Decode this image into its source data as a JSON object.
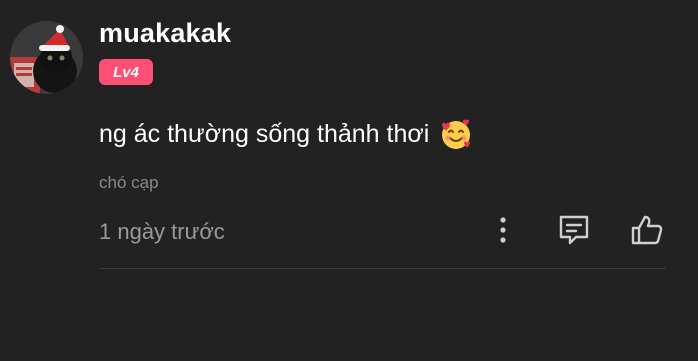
{
  "comment": {
    "username": "muakakak",
    "level": "Lv4",
    "text": "ng ác thường sống thảnh thơi",
    "emoji": "smiling-face-with-hearts",
    "reply_to": "chó cạp",
    "timestamp": "1 ngày trước"
  },
  "icons": {
    "more": "vertical-ellipsis-icon",
    "reply": "comment-icon",
    "like": "thumbs-up-icon"
  },
  "colors": {
    "background": "#222223",
    "badge": "#ff4f74",
    "muted_text": "#8a8a8a",
    "icon": "#cfcfcf"
  }
}
